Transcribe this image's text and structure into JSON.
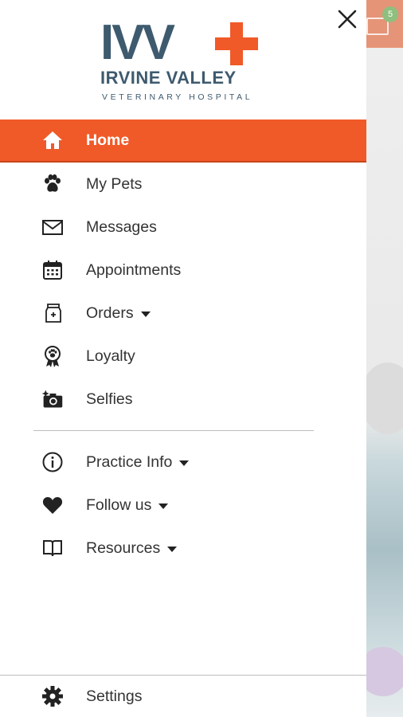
{
  "background": {
    "badge_count": "5"
  },
  "logo": {
    "mark": "IVV",
    "name": "IRVINE VALLEY",
    "subtitle": "VETERINARY HOSPITAL"
  },
  "colors": {
    "accent": "#f05a28",
    "brand": "#3e5a6e",
    "text": "#333333"
  },
  "menu": {
    "items": [
      {
        "label": "Home",
        "icon": "home-icon",
        "active": true
      },
      {
        "label": "My Pets",
        "icon": "paw-icon"
      },
      {
        "label": "Messages",
        "icon": "envelope-icon"
      },
      {
        "label": "Appointments",
        "icon": "calendar-icon"
      },
      {
        "label": "Orders",
        "icon": "pet-food-bag-icon",
        "has_dropdown": true
      },
      {
        "label": "Loyalty",
        "icon": "award-ribbon-icon"
      },
      {
        "label": "Selfies",
        "icon": "camera-icon"
      }
    ],
    "secondary": [
      {
        "label": "Practice Info",
        "icon": "info-icon",
        "has_dropdown": true
      },
      {
        "label": "Follow us",
        "icon": "heart-icon",
        "has_dropdown": true
      },
      {
        "label": "Resources",
        "icon": "book-icon",
        "has_dropdown": true
      }
    ],
    "settings": {
      "label": "Settings",
      "icon": "gear-icon"
    }
  }
}
